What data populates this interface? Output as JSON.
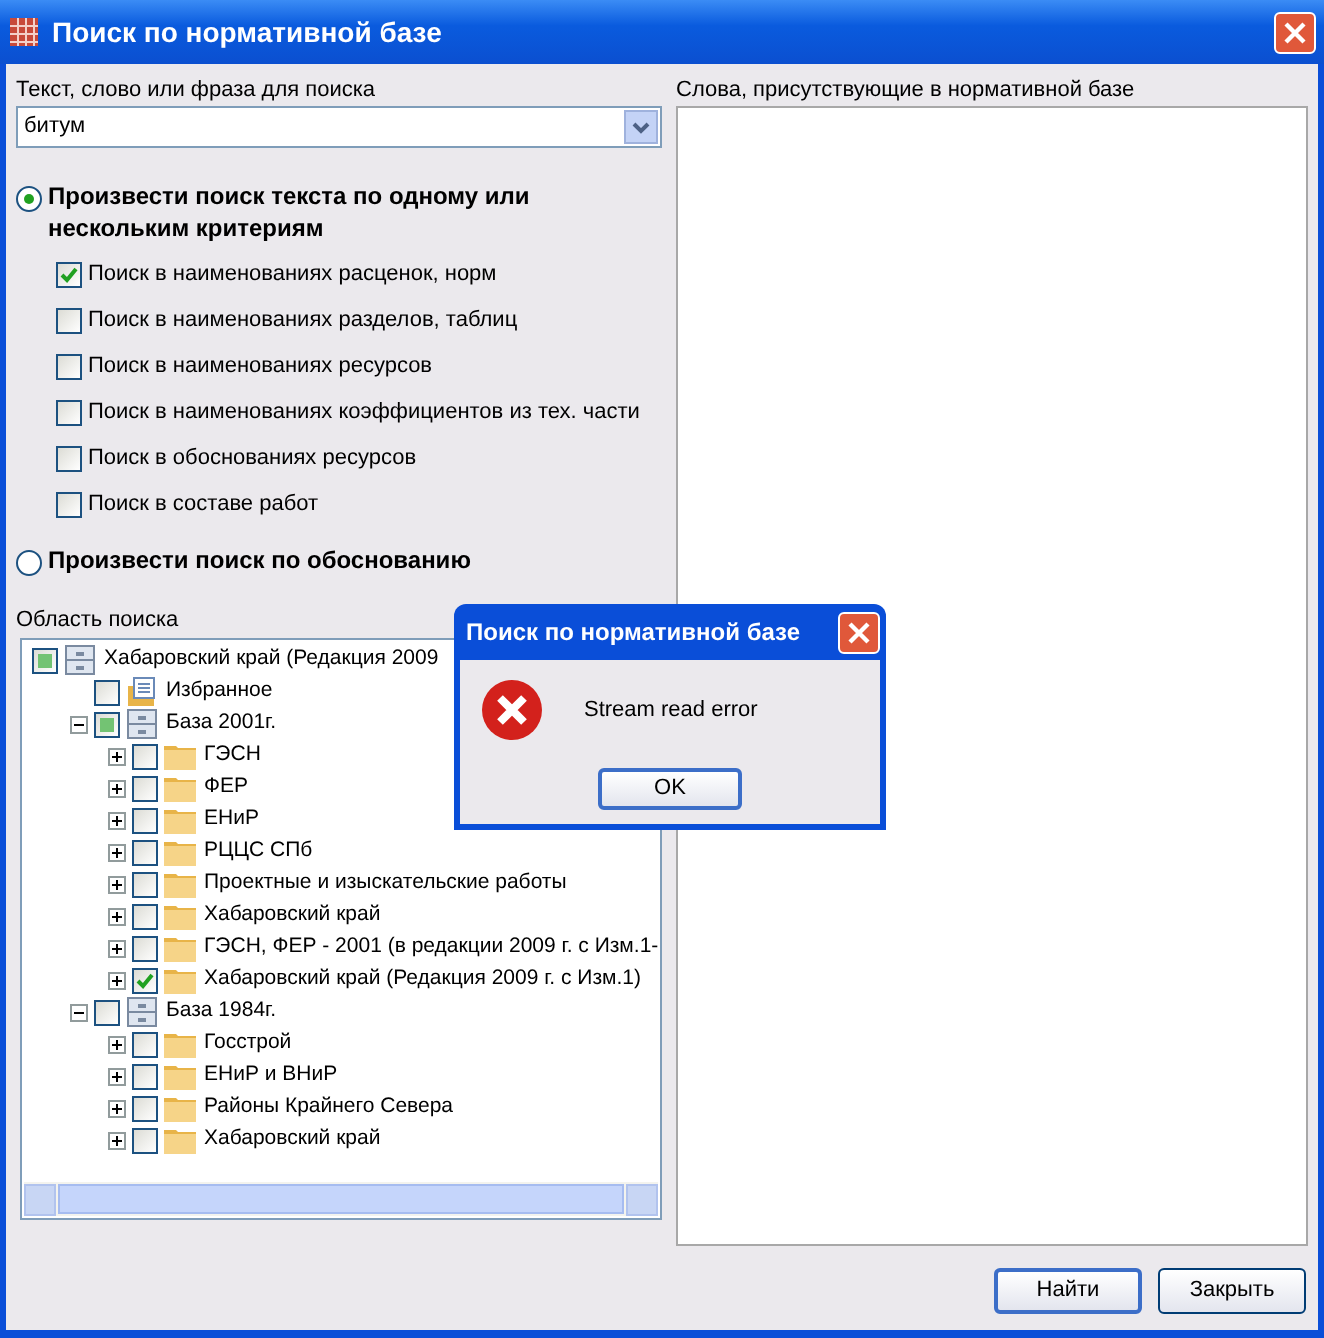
{
  "window": {
    "title": "Поиск по нормативной базе"
  },
  "search": {
    "label": "Текст, слово или фраза для поиска",
    "value": "битум"
  },
  "modes": [
    {
      "label": "Произвести поиск текста по одному или нескольким критериям",
      "selected": true,
      "options": [
        {
          "label": "Поиск в наименованиях расценок, норм",
          "checked": true
        },
        {
          "label": "Поиск в наименованиях разделов, таблиц",
          "checked": false
        },
        {
          "label": "Поиск в наименованиях ресурсов",
          "checked": false
        },
        {
          "label": "Поиск в наименованиях коэффициентов из тех. части",
          "checked": false
        },
        {
          "label": "Поиск в обоснованиях ресурсов",
          "checked": false
        },
        {
          "label": "Поиск в составе работ",
          "checked": false
        }
      ]
    },
    {
      "label": "Произвести поиск по обоснованию",
      "selected": false
    }
  ],
  "scope": {
    "label": "Область поиска",
    "tree": [
      {
        "label": "Хабаровский край (Редакция 2009",
        "kind": "database",
        "checked": false,
        "partial": true,
        "children": [
          {
            "label": "Избранное",
            "kind": "favorites",
            "checked": false,
            "partial": false
          },
          {
            "label": "База 2001г.",
            "kind": "database",
            "checked": false,
            "partial": true,
            "expanded": true,
            "children": [
              {
                "label": "ГЭСН",
                "kind": "folder",
                "checked": false,
                "partial": false,
                "expanded": false
              },
              {
                "label": "ФЕР",
                "kind": "folder",
                "checked": false,
                "partial": false,
                "expanded": false
              },
              {
                "label": "ЕНиР",
                "kind": "folder",
                "checked": false,
                "partial": false,
                "expanded": false
              },
              {
                "label": "РЦЦС СПб",
                "kind": "folder",
                "checked": false,
                "partial": false,
                "expanded": false
              },
              {
                "label": "Проектные и изыскательские работы",
                "kind": "folder",
                "checked": false,
                "partial": false,
                "expanded": false
              },
              {
                "label": "Хабаровский край",
                "kind": "folder",
                "checked": false,
                "partial": false,
                "expanded": false
              },
              {
                "label": "ГЭСН, ФЕР - 2001 (в редакции 2009 г. с Изм.1-",
                "kind": "folder",
                "checked": false,
                "partial": false,
                "expanded": false
              },
              {
                "label": "Хабаровский край (Редакция 2009 г. с Изм.1)",
                "kind": "folder",
                "checked": true,
                "partial": false,
                "expanded": false
              }
            ]
          },
          {
            "label": "База 1984г.",
            "kind": "database",
            "checked": false,
            "partial": false,
            "expanded": true,
            "children": [
              {
                "label": "Госстрой",
                "kind": "folder",
                "checked": false,
                "partial": false,
                "expanded": false
              },
              {
                "label": "ЕНиР и ВНиР",
                "kind": "folder",
                "checked": false,
                "partial": false,
                "expanded": false
              },
              {
                "label": "Районы Крайнего Севера",
                "kind": "folder",
                "checked": false,
                "partial": false,
                "expanded": false
              },
              {
                "label": "Хабаровский край",
                "kind": "folder",
                "checked": false,
                "partial": false,
                "expanded": false
              }
            ]
          }
        ]
      }
    ]
  },
  "words": {
    "label": "Слова, присутствующие в нормативной базе"
  },
  "buttons": [
    {
      "label": "Найти",
      "default": true
    },
    {
      "label": "Закрыть",
      "default": false
    }
  ],
  "dialog": {
    "title": "Поиск по нормативной базе",
    "message": "Stream read error",
    "button": "OK"
  }
}
